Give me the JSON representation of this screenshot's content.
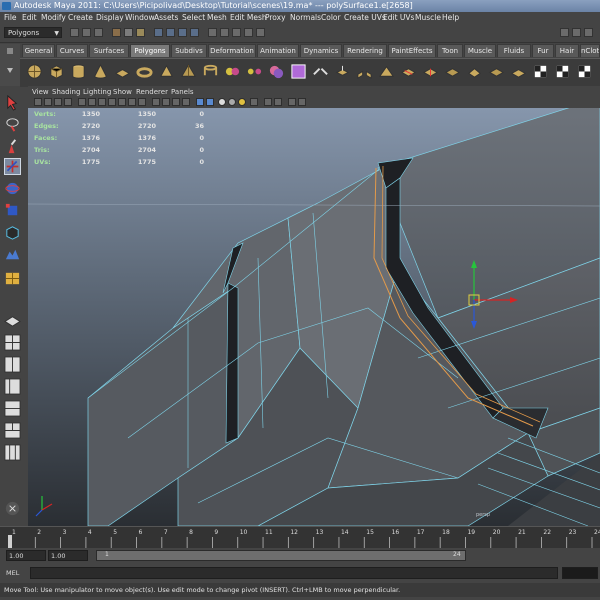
{
  "window": {
    "title": "Autodesk Maya 2011: C:\\Users\\Picipolivad\\Desktop\\Tutorial\\scenes\\19.ma* --- polySurface1.e[2658]"
  },
  "menu": [
    "File",
    "Edit",
    "Modify",
    "Create",
    "Display",
    "Window",
    "Assets",
    "Select",
    "Mesh",
    "Edit Mesh",
    "Proxy",
    "Normals",
    "Color",
    "Create UVs",
    "Edit UVs",
    "Muscle",
    "Help"
  ],
  "mode_menu": {
    "value": "Polygons"
  },
  "shelf_tabs": [
    "General",
    "Curves",
    "Surfaces",
    "Polygons",
    "Subdivs",
    "Deformation",
    "Animation",
    "Dynamics",
    "Rendering",
    "PaintEffects",
    "Toon",
    "Muscle",
    "Fluids",
    "Fur",
    "Hair",
    "nCloth"
  ],
  "active_shelf_tab": "Polygons",
  "panel_menu": [
    "View",
    "Shading",
    "Lighting",
    "Show",
    "Renderer",
    "Panels"
  ],
  "hud": {
    "rows": [
      {
        "label": "Verts:",
        "values": [
          "1350",
          "1350",
          "0"
        ]
      },
      {
        "label": "Edges:",
        "values": [
          "2720",
          "2720",
          "36"
        ]
      },
      {
        "label": "Faces:",
        "values": [
          "1376",
          "1376",
          "0"
        ]
      },
      {
        "label": "Tris:",
        "values": [
          "2704",
          "2704",
          "0"
        ]
      },
      {
        "label": "UVs:",
        "values": [
          "1775",
          "1775",
          "0"
        ]
      }
    ]
  },
  "camera_label": "persp",
  "timeline": {
    "ticks": [
      "1",
      "2",
      "3",
      "4",
      "5",
      "6",
      "7",
      "8",
      "9",
      "10",
      "11",
      "12",
      "13",
      "14",
      "15",
      "16",
      "17",
      "18",
      "19",
      "20",
      "21",
      "22",
      "23",
      "24"
    ],
    "current": 1
  },
  "range": {
    "start": "1.00",
    "start_inner": "1.00",
    "slider_start": "1",
    "slider_end": "24"
  },
  "cmdline": {
    "label": "MEL",
    "value": ""
  },
  "helpline": "Move Tool: Use manipulator to move object(s). Use edit mode to change pivot (INSERT). Ctrl+LMB to move perpendicular.",
  "colors": {
    "wire": "#7fd3e8",
    "selected_edge": "#e39a4a",
    "hud_label": "#a8e3a0",
    "move_x": "#d42424",
    "move_y": "#26c43c",
    "move_z": "#2a58d8"
  }
}
